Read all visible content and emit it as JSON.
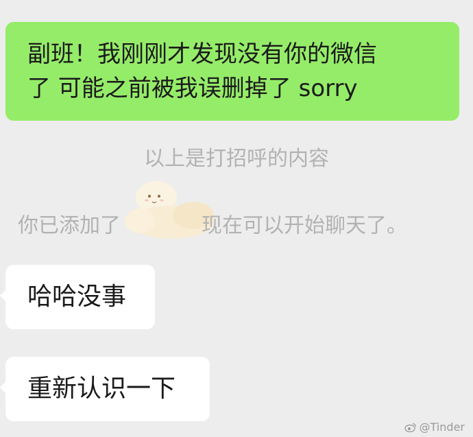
{
  "messages": {
    "outgoing": {
      "line1": "副班！我刚刚才发现没有你的微信",
      "line2": "了 可能之前被我误删掉了 sorry"
    },
    "incoming": [
      {
        "text": "哈哈没事"
      },
      {
        "text": "重新认识一下"
      }
    ]
  },
  "system": {
    "greeting_note": "以上是打招呼的内容",
    "added_prefix": "你已添加了",
    "added_suffix": "现在可以开始聊天了。"
  },
  "watermark": {
    "text": "@Tinder",
    "icon": "weibo-icon"
  },
  "colors": {
    "background": "#ededed",
    "outgoing_bubble": "#95ec69",
    "incoming_bubble": "#ffffff",
    "system_text": "#b2b2b2"
  }
}
